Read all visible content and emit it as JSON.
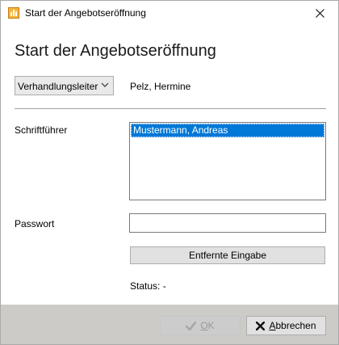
{
  "window": {
    "title": "Start der Angebotseröffnung"
  },
  "main": {
    "heading": "Start der Angebotseröffnung",
    "leader_role_select": {
      "selected": "Verhandlungsleiter"
    },
    "leader_name": "Pelz, Hermine",
    "recorder_label": "Schriftführer",
    "recorder_list": {
      "items": [
        "Mustermann, Andreas"
      ],
      "selected_index": 0
    },
    "password_label": "Passwort",
    "password_value": "",
    "remote_entry_button": "Entfernte Eingabe",
    "status": "Status: -"
  },
  "footer": {
    "ok": {
      "label_first": "O",
      "label_rest": "K",
      "enabled": false,
      "icon": "checkmark-icon"
    },
    "cancel": {
      "label_first": "A",
      "label_rest": "bbrechen",
      "icon": "x-icon"
    }
  },
  "colors": {
    "selection": "#0078d7",
    "footer_bg": "#cdcbc7",
    "app_icon": "#f4b63a"
  }
}
